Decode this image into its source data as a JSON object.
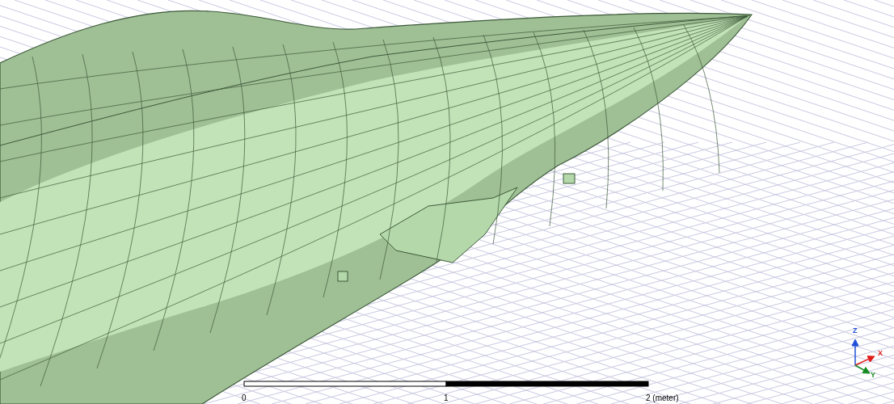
{
  "scale_bar": {
    "labels": [
      "0",
      "1",
      "2 (meter)"
    ]
  },
  "axes": [
    {
      "label": "Z",
      "color": "#1f4fd8"
    },
    {
      "label": "X",
      "color": "#e01b1b"
    },
    {
      "label": "Y",
      "color": "#138a1f"
    }
  ]
}
